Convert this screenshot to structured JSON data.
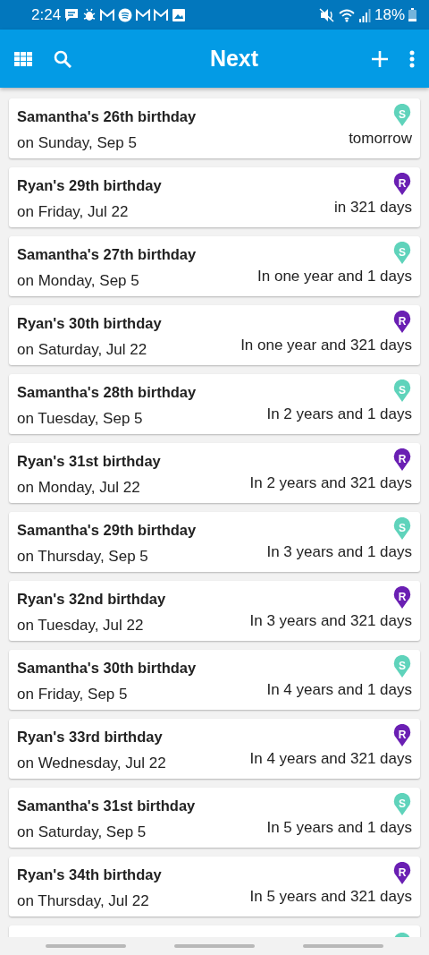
{
  "status_bar": {
    "time": "2:24",
    "battery": "18%"
  },
  "app_bar": {
    "title": "Next"
  },
  "events": [
    {
      "title": "Samantha's 26th birthday",
      "date": "on Sunday, Sep 5",
      "when": "tomorrow",
      "initial": "S",
      "color": "#5fd3bb"
    },
    {
      "title": "Ryan's 29th birthday",
      "date": "on Friday, Jul 22",
      "when": "in 321 days",
      "initial": "R",
      "color": "#6a1fb3"
    },
    {
      "title": "Samantha's 27th birthday",
      "date": "on Monday, Sep 5",
      "when": "In one year and 1 days",
      "initial": "S",
      "color": "#5fd3bb"
    },
    {
      "title": "Ryan's 30th birthday",
      "date": "on Saturday, Jul 22",
      "when": "In one year and 321 days",
      "initial": "R",
      "color": "#6a1fb3"
    },
    {
      "title": "Samantha's 28th birthday",
      "date": "on Tuesday, Sep 5",
      "when": "In 2 years and 1 days",
      "initial": "S",
      "color": "#5fd3bb"
    },
    {
      "title": "Ryan's 31st birthday",
      "date": "on Monday, Jul 22",
      "when": "In 2 years and 321 days",
      "initial": "R",
      "color": "#6a1fb3"
    },
    {
      "title": "Samantha's 29th birthday",
      "date": "on Thursday, Sep 5",
      "when": "In 3 years and 1 days",
      "initial": "S",
      "color": "#5fd3bb"
    },
    {
      "title": "Ryan's 32nd birthday",
      "date": "on Tuesday, Jul 22",
      "when": "In 3 years and 321 days",
      "initial": "R",
      "color": "#6a1fb3"
    },
    {
      "title": "Samantha's 30th birthday",
      "date": "on Friday, Sep 5",
      "when": "In 4 years and 1 days",
      "initial": "S",
      "color": "#5fd3bb"
    },
    {
      "title": "Ryan's 33rd birthday",
      "date": "on Wednesday, Jul 22",
      "when": "In 4 years and 321 days",
      "initial": "R",
      "color": "#6a1fb3"
    },
    {
      "title": "Samantha's 31st birthday",
      "date": "on Saturday, Sep 5",
      "when": "In 5 years and 1 days",
      "initial": "S",
      "color": "#5fd3bb"
    },
    {
      "title": "Ryan's 34th birthday",
      "date": "on Thursday, Jul 22",
      "when": "In 5 years and 321 days",
      "initial": "R",
      "color": "#6a1fb3"
    }
  ],
  "partial_event": {
    "color": "#5fd3bb"
  }
}
